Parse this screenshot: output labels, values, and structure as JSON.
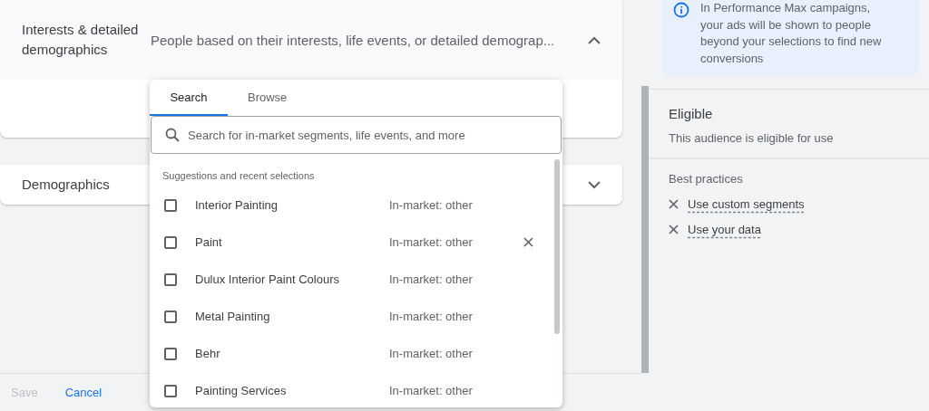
{
  "sections": [
    {
      "title": "Interests & detailed demographics",
      "summary": "People based on their interests, life events, or detailed demograp...",
      "expanded": true
    },
    {
      "title": "Demographics",
      "expanded": false
    }
  ],
  "dropdown": {
    "tabs": [
      {
        "label": "Search",
        "selected": true
      },
      {
        "label": "Browse",
        "selected": false
      }
    ],
    "search": {
      "placeholder": "Search for in-market segments, life events, and more"
    },
    "list_heading": "Suggestions and recent selections",
    "items": [
      {
        "name": "Interior Painting",
        "category": "In-market: other",
        "checked": false,
        "removable": false
      },
      {
        "name": "Paint",
        "category": "In-market: other",
        "checked": false,
        "removable": true
      },
      {
        "name": "Dulux Interior Paint Colours",
        "category": "In-market: other",
        "checked": false,
        "removable": false
      },
      {
        "name": "Metal Painting",
        "category": "In-market: other",
        "checked": false,
        "removable": false
      },
      {
        "name": "Behr",
        "category": "In-market: other",
        "checked": false,
        "removable": false
      },
      {
        "name": "Painting Services",
        "category": "In-market: other",
        "checked": false,
        "removable": false
      }
    ]
  },
  "footer": {
    "buttons": [
      {
        "label": "Save",
        "disabled": true
      },
      {
        "label": "Cancel",
        "disabled": false
      }
    ]
  },
  "side_panel": {
    "info": "In Performance Max campaigns, your ads will be shown to people beyond your selections to find new conversions",
    "status_title": "Eligible",
    "status_text": "This audience is eligible for use",
    "best_practices_heading": "Best practices",
    "best_practices": [
      {
        "label": "Use custom segments",
        "met": false
      },
      {
        "label": "Use your data",
        "met": false
      }
    ]
  }
}
